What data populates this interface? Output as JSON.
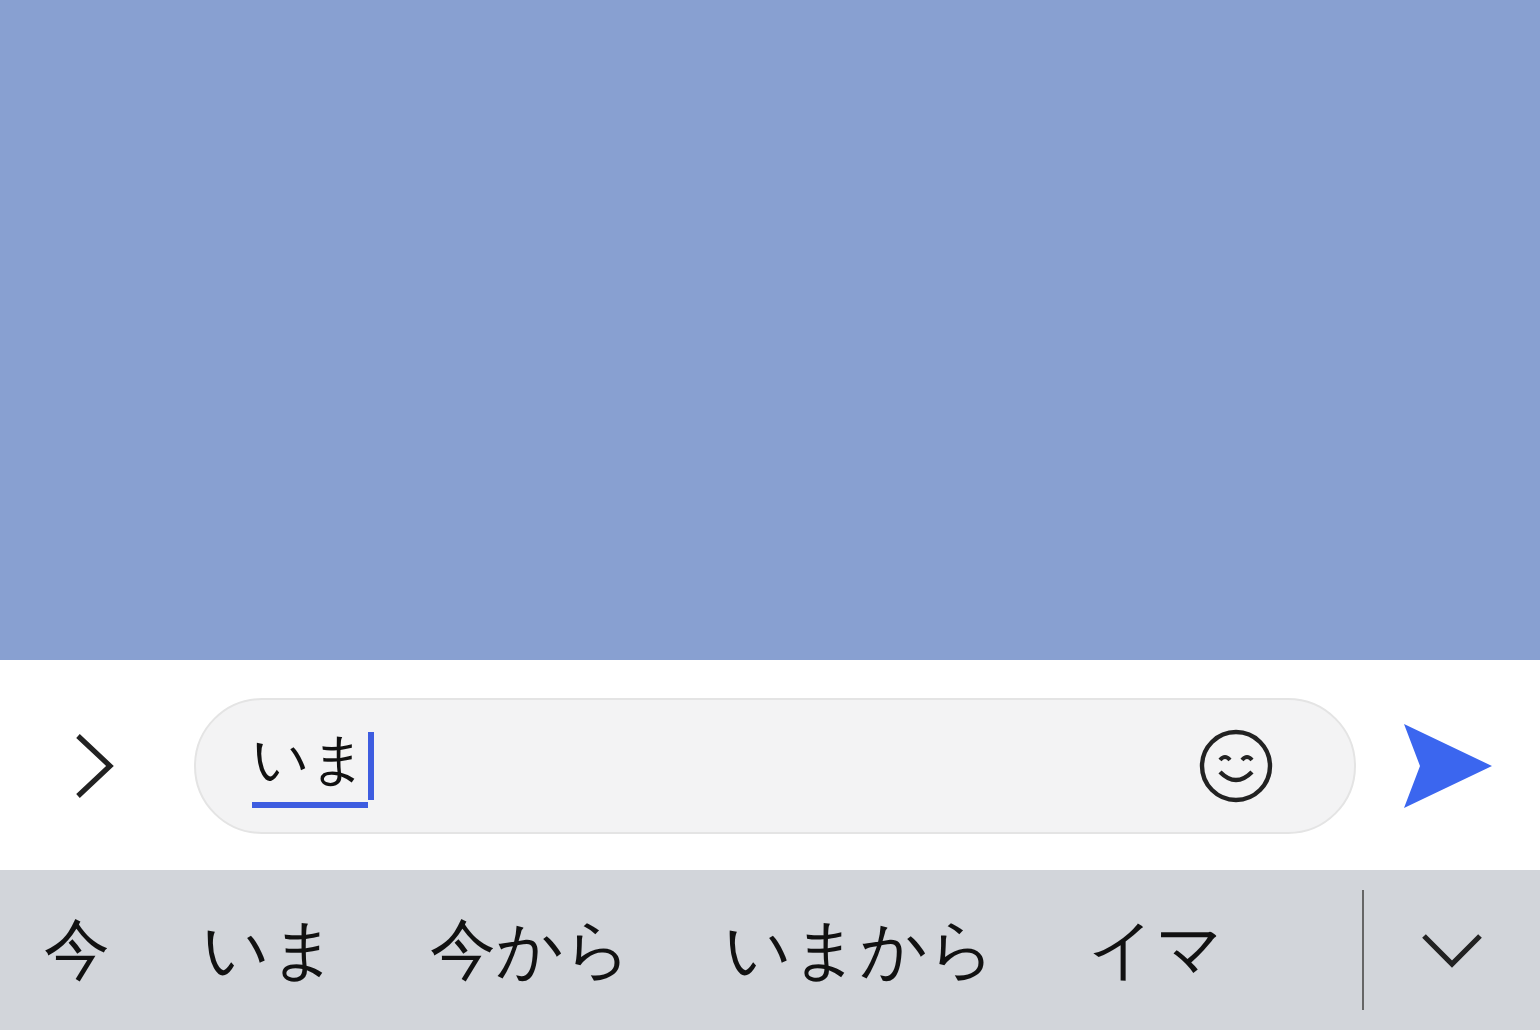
{
  "composer": {
    "value": "いま",
    "composing": true
  },
  "candidates": [
    "今",
    "いま",
    "今から",
    "いまから",
    "イマ"
  ]
}
